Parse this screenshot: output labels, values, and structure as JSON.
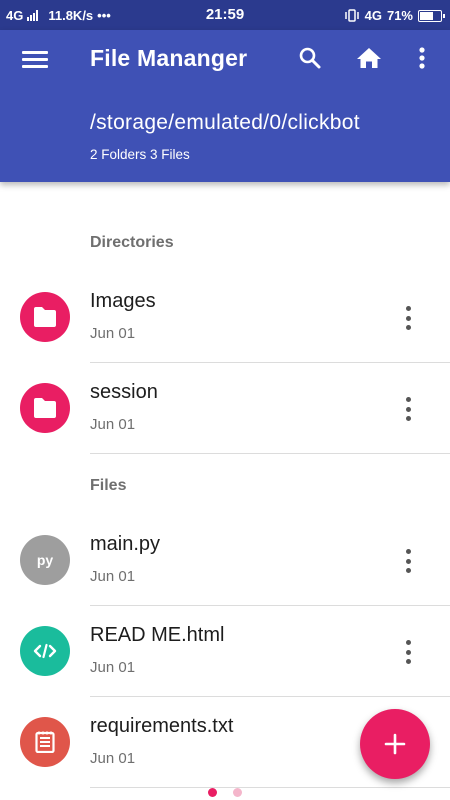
{
  "status_bar": {
    "network_left": "4G",
    "speed": "11.8K/s",
    "dots": "•••",
    "time": "21:59",
    "network_right": "4G",
    "battery": "71%",
    "battery_level": 0.71
  },
  "app_bar": {
    "title": "File Mananger",
    "path": "/storage/emulated/0/clickbot",
    "counts": "2 Folders 3 Files"
  },
  "sections": {
    "directories": "Directories",
    "files": "Files"
  },
  "directories": [
    {
      "name": "Images",
      "date": "Jun 01",
      "icon": "folder-icon",
      "color": "#e91e63"
    },
    {
      "name": "session",
      "date": "Jun 01",
      "icon": "folder-icon",
      "color": "#e91e63"
    }
  ],
  "files": [
    {
      "name": "main.py",
      "date": "Jun 01",
      "icon_text": "py",
      "icon": "python-file-icon",
      "color": "#9e9e9e"
    },
    {
      "name": "READ ME.html",
      "date": "Jun 01",
      "icon": "code-icon",
      "color": "#1abc9c"
    },
    {
      "name": "requirements.txt",
      "date": "Jun 01",
      "icon": "text-file-icon",
      "color": "#e0564a"
    }
  ],
  "colors": {
    "status_bar": "#2b3a8e",
    "primary": "#3f51b5",
    "accent": "#e91e63",
    "pager_active": "#e91e63",
    "pager_inactive": "#f4b6cb"
  }
}
